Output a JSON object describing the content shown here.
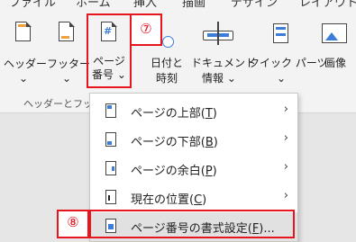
{
  "tabs": [
    "ファイル",
    "ホーム",
    "挿入",
    "描画",
    "デザイン",
    "レイアウト"
  ],
  "ribbon": {
    "header": {
      "label": "ヘッダー",
      "chevron": "⌄"
    },
    "footer": {
      "label": "フッター",
      "chevron": "⌄"
    },
    "page_number": {
      "line1": "ページ",
      "line2": "番号",
      "chevron": "⌄"
    },
    "date_time": {
      "line1": "日付と",
      "line2": "時刻"
    },
    "doc_info": {
      "line1": "ドキュメント",
      "line2": "情報",
      "chevron": "⌄"
    },
    "quick_parts": {
      "label": "クイック パーツ",
      "chevron": "⌄"
    },
    "image": {
      "label": "画像"
    },
    "group_label": "ヘッダーとフッ"
  },
  "annotations": {
    "seven": "⑦",
    "eight": "⑧"
  },
  "menu": {
    "items": [
      {
        "label": "ページの上部(",
        "key": "T",
        "suffix": ")",
        "arrow": "›"
      },
      {
        "label": "ページの下部(",
        "key": "B",
        "suffix": ")",
        "arrow": "›"
      },
      {
        "label": "ページの余白(",
        "key": "P",
        "suffix": ")",
        "arrow": "›"
      },
      {
        "label": "現在の位置(",
        "key": "C",
        "suffix": ")",
        "arrow": "›"
      },
      {
        "label": "ページ番号の書式設定(",
        "key": "F",
        "suffix": ")..."
      }
    ]
  },
  "colors": {
    "highlight": "#e8141e",
    "accent": "#3b7dd8"
  }
}
